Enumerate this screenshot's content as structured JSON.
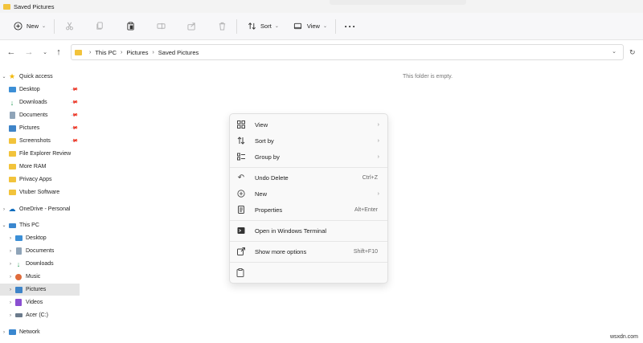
{
  "window": {
    "title": "Saved Pictures"
  },
  "toolbar": {
    "new_label": "New",
    "sort_label": "Sort",
    "view_label": "View",
    "icons": [
      "plus-circle-icon",
      "cut-icon",
      "copy-icon",
      "paste-icon",
      "rename-icon",
      "share-icon",
      "delete-icon",
      "sort-icon",
      "view-icon",
      "more-icon"
    ]
  },
  "address": {
    "crumbs": [
      "This PC",
      "Pictures",
      "Saved Pictures"
    ]
  },
  "sidebar": {
    "quick_access": {
      "label": "Quick access"
    },
    "items": [
      {
        "label": "Desktop",
        "pinned": true
      },
      {
        "label": "Downloads",
        "pinned": true
      },
      {
        "label": "Documents",
        "pinned": true
      },
      {
        "label": "Pictures",
        "pinned": true
      },
      {
        "label": "Screenshots",
        "pinned": true
      },
      {
        "label": "File Explorer Review",
        "pinned": false
      },
      {
        "label": "More RAM",
        "pinned": false
      },
      {
        "label": "Privacy Apps",
        "pinned": false
      },
      {
        "label": "Vtuber Software",
        "pinned": false
      }
    ],
    "onedrive": {
      "label": "OneDrive - Personal"
    },
    "this_pc": {
      "label": "This PC"
    },
    "pc_items": [
      {
        "label": "Desktop"
      },
      {
        "label": "Documents"
      },
      {
        "label": "Downloads"
      },
      {
        "label": "Music"
      },
      {
        "label": "Pictures"
      },
      {
        "label": "Videos"
      },
      {
        "label": "Acer (C:)"
      }
    ],
    "network": {
      "label": "Network"
    }
  },
  "main": {
    "empty_text": "This folder is empty."
  },
  "context_menu": {
    "view": "View",
    "sort_by": "Sort by",
    "group_by": "Group by",
    "undo_delete": "Undo Delete",
    "undo_shortcut": "Ctrl+Z",
    "new": "New",
    "properties": "Properties",
    "properties_shortcut": "Alt+Enter",
    "open_terminal": "Open in Windows Terminal",
    "show_more": "Show more options",
    "show_more_shortcut": "Shift+F10"
  },
  "watermark": "wsxdn.com",
  "colors": {
    "folder": "#f2c33b",
    "accent": "#0067c0",
    "selected": "#e5e5e5"
  }
}
